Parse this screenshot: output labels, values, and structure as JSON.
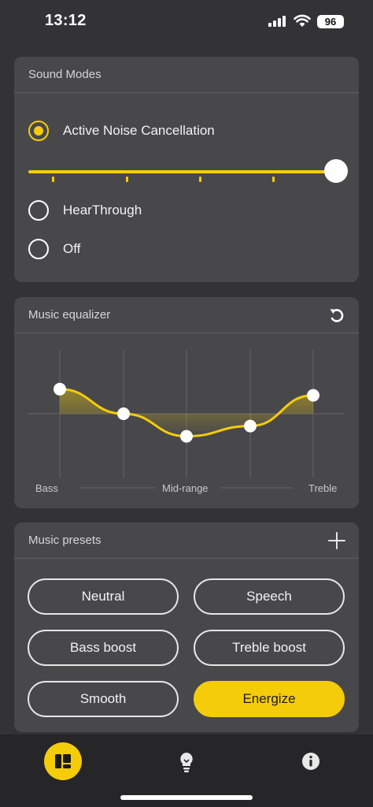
{
  "status_bar": {
    "time": "13:12",
    "battery": "96",
    "icons": [
      "signal-icon",
      "wifi-icon",
      "battery-icon"
    ]
  },
  "sound_modes": {
    "title": "Sound Modes",
    "options": [
      {
        "label": "Active Noise Cancellation",
        "selected": true
      },
      {
        "label": "HearThrough",
        "selected": false
      },
      {
        "label": "Off",
        "selected": false
      }
    ],
    "anc_level": 1.0
  },
  "equalizer": {
    "title": "Music equalizer",
    "reset_icon": "reset-icon",
    "labels": {
      "bass": "Bass",
      "mid": "Mid-range",
      "treble": "Treble"
    },
    "band_levels": [
      0.6,
      0.0,
      -0.55,
      -0.3,
      0.45
    ]
  },
  "presets": {
    "title": "Music presets",
    "add_icon": "plus-icon",
    "items": [
      "Neutral",
      "Speech",
      "Bass boost",
      "Treble boost",
      "Smooth",
      "Energize"
    ],
    "active": "Energize"
  },
  "nav": {
    "items": [
      "dashboard-icon",
      "lightbulb-icon",
      "info-icon"
    ],
    "active": "dashboard-icon"
  },
  "colors": {
    "accent": "#f5cc0a",
    "background": "#333335",
    "card": "#48484b"
  }
}
